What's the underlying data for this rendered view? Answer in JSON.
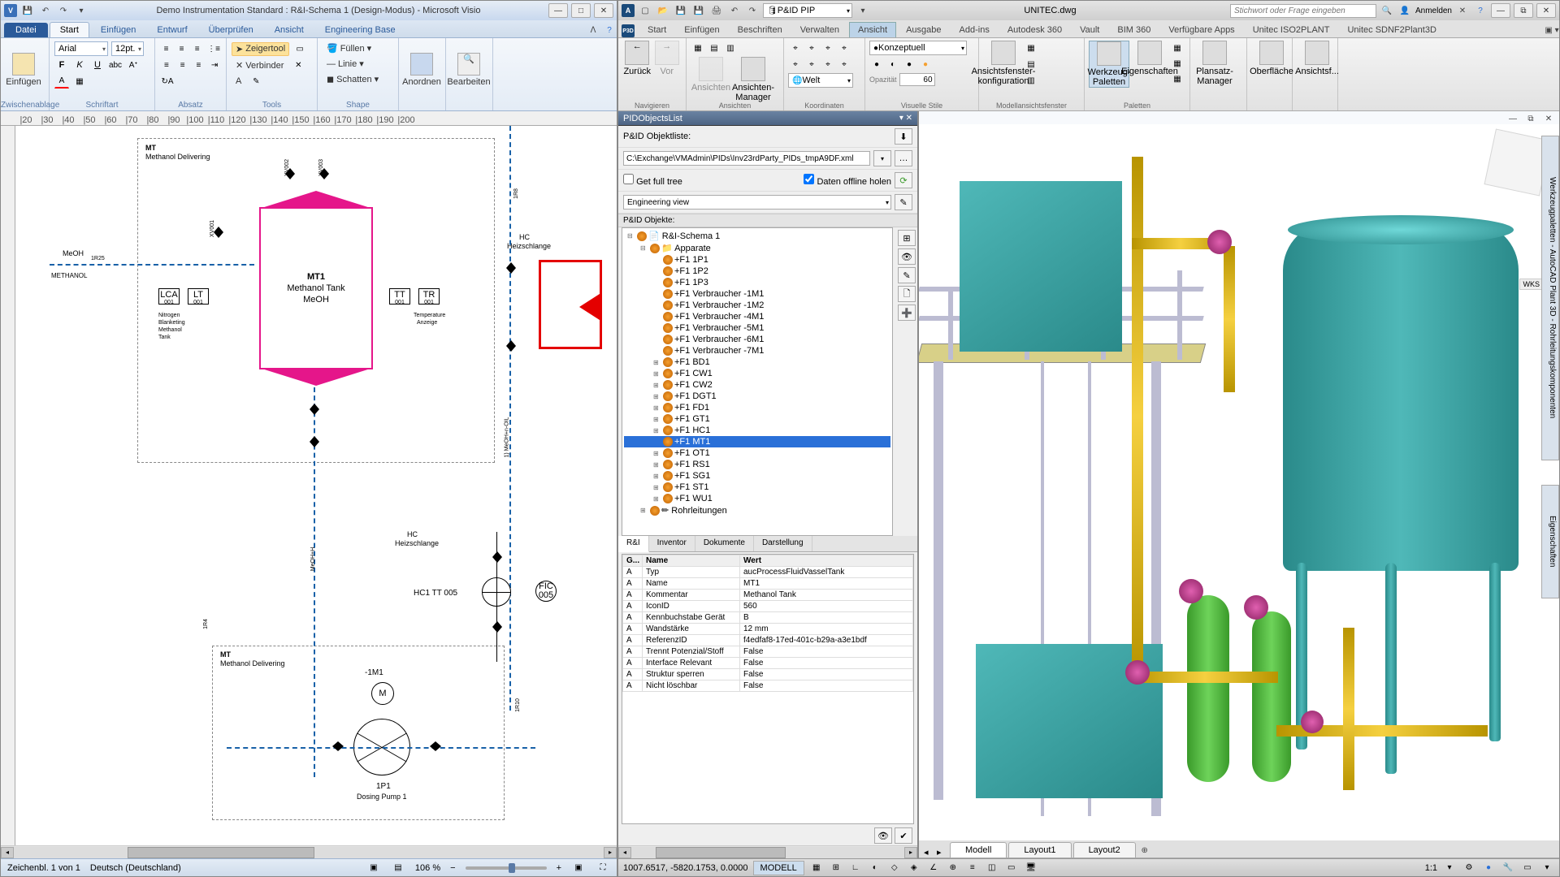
{
  "visio": {
    "title": "Demo Instrumentation Standard : R&I-Schema 1 (Design-Modus) - Microsoft Visio",
    "tabs": {
      "file": "Datei",
      "start": "Start",
      "einf": "Einfügen",
      "entw": "Entwurf",
      "uber": "Überprüfen",
      "ansicht": "Ansicht",
      "eng": "Engineering Base"
    },
    "ribbon": {
      "paste": "Einfügen",
      "clipboard": "Zwischenablage",
      "font": "Arial",
      "fontsize": "12pt.",
      "schrift": "Schriftart",
      "absatz": "Absatz",
      "pointer": "Zeigertool",
      "connector": "✕ Verbinder",
      "text": "A",
      "tools": "Tools",
      "fill": "Füllen",
      "line": "Linie",
      "shadow": "Schatten",
      "shape": "Shape",
      "arrange": "Anordnen",
      "edit": "Bearbeiten"
    },
    "drawing": {
      "MT_h1": "MT",
      "MT_h2": "Methanol Delivering",
      "tank_id": "MT1",
      "tank_name": "Methanol Tank",
      "tank_sub": "MeOH",
      "meoh": "MeOH",
      "methanol": "METHANOL",
      "xv001": "XV001",
      "r25": "1R25",
      "nlabel1": "Nitrogen",
      "nlabel2": "Blanketing",
      "nlabel3": "Methanol",
      "nlabel4": "Tank",
      "lca": "LCA",
      "lt": "LT",
      "tt": "TT",
      "tr": "TR",
      "temp": "Temperature",
      "anz": "Anzeige",
      "xv002": "XV002",
      "xv003": "XV003",
      "hc": "HC",
      "heiz": "Heizschlange",
      "hc1": "HC1 TT 005",
      "fic": "FIC",
      "fic2": "005",
      "m1": "-1M1",
      "M": "M",
      "p1": "1P1",
      "dosing": "Dosing Pump 1",
      "r8": "1R8",
      "r4": "1R4",
      "r10": "1R10",
      "meohh": "MeOH+H",
      "meohoil": "1) MeOH+n-OIL"
    },
    "status": {
      "sheet": "Zeichenbl. 1 von 1",
      "lang": "Deutsch (Deutschland)",
      "zoom": "106 %"
    }
  },
  "autocad": {
    "qat_combo": "P&ID PIP",
    "file": "UNITEC.dwg",
    "search_ph": "Stichwort oder Frage eingeben",
    "signin": "Anmelden",
    "tabs": [
      "Start",
      "Einfügen",
      "Beschriften",
      "Verwalten",
      "Ansicht",
      "Ausgabe",
      "Add-ins",
      "Autodesk 360",
      "Vault",
      "BIM 360",
      "Verfügbare Apps",
      "Unitec ISO2PLANT",
      "Unitec SDNF2Plant3D"
    ],
    "groups": {
      "nav": {
        "back": "Zurück",
        "fwd": "Vor",
        "title": "Navigieren"
      },
      "ansichten": {
        "views": "Ansichten",
        "mgr": "Ansichten-Manager",
        "title": "Ansichten"
      },
      "koord": {
        "world": "Welt",
        "title": "Koordinaten"
      },
      "visual": {
        "concept": "Konzeptuell",
        "opac": "Opazität",
        "opacval": "60",
        "title": "Visuelle Stile"
      },
      "model": {
        "cfg": "Ansichtsfenster-konfiguration",
        "title": "Modellansichtsfenster"
      },
      "pal": {
        "tool": "Werkzeug-Paletten",
        "props": "Eigenschaften",
        "title": "Paletten"
      },
      "layout": {
        "mgr": "Plansatz-Manager"
      },
      "surf": "Oberfläche",
      "sect": "Ansichtsf..."
    },
    "pid": {
      "title": "PIDObjectsList",
      "label": "P&ID Objektliste:",
      "path": "C:\\Exchange\\VMAdmin\\PIDs\\Inv23rdParty_PIDs_tmpA9DF.xml",
      "full": "Get full tree",
      "offline": "Daten offline holen",
      "view": "Engineering view",
      "objs": "P&ID Objekte:",
      "root": "R&I-Schema 1",
      "apparate": "Apparate",
      "rohr": "Rohrleitungen",
      "items": [
        "+F1 1P1",
        "+F1 1P2",
        "+F1 1P3",
        "+F1 Verbraucher -1M1",
        "+F1 Verbraucher -1M2",
        "+F1 Verbraucher -4M1",
        "+F1 Verbraucher -5M1",
        "+F1 Verbraucher -6M1",
        "+F1 Verbraucher -7M1",
        "+F1 BD1",
        "+F1 CW1",
        "+F1 CW2",
        "+F1 DGT1",
        "+F1 FD1",
        "+F1 GT1",
        "+F1 HC1",
        "+F1 MT1",
        "+F1 OT1",
        "+F1 RS1",
        "+F1 SG1",
        "+F1 ST1",
        "+F1 WU1"
      ]
    },
    "proptabs": [
      "R&I",
      "Inventor",
      "Dokumente",
      "Darstellung"
    ],
    "propcols": {
      "g": "G...",
      "name": "Name",
      "wert": "Wert"
    },
    "props": [
      {
        "g": "A",
        "n": "Typ",
        "v": "aucProcessFluidVasselTank"
      },
      {
        "g": "A",
        "n": "Name",
        "v": "MT1"
      },
      {
        "g": "A",
        "n": "Kommentar",
        "v": "Methanol Tank"
      },
      {
        "g": "A",
        "n": "IconID",
        "v": "560"
      },
      {
        "g": "A",
        "n": "Kennbuchstabe Gerät",
        "v": "B"
      },
      {
        "g": "A",
        "n": "Wandstärke",
        "v": "12 mm"
      },
      {
        "g": "A",
        "n": "ReferenzID",
        "v": "f4edfaf8-17ed-401c-b29a-a3e1bdf"
      },
      {
        "g": "A",
        "n": "Trennt Potenzial/Stoff",
        "v": "False"
      },
      {
        "g": "A",
        "n": "Interface Relevant",
        "v": "False"
      },
      {
        "g": "A",
        "n": "Struktur sperren",
        "v": "False"
      },
      {
        "g": "A",
        "n": "Nicht löschbar",
        "v": "False"
      }
    ],
    "footer": {
      "m": "Modell",
      "l1": "Layout1",
      "l2": "Layout2",
      "coords": "1007.6517, -5820.1753, 0.0000",
      "model": "MODELL",
      "scale": "1:1",
      "wks": "WKS"
    },
    "side": {
      "pal": "Werkzeugpaletten - AutoCAD Plant 3D - Rohrleitungskomponenten",
      "props": "Eigenschaften"
    }
  }
}
